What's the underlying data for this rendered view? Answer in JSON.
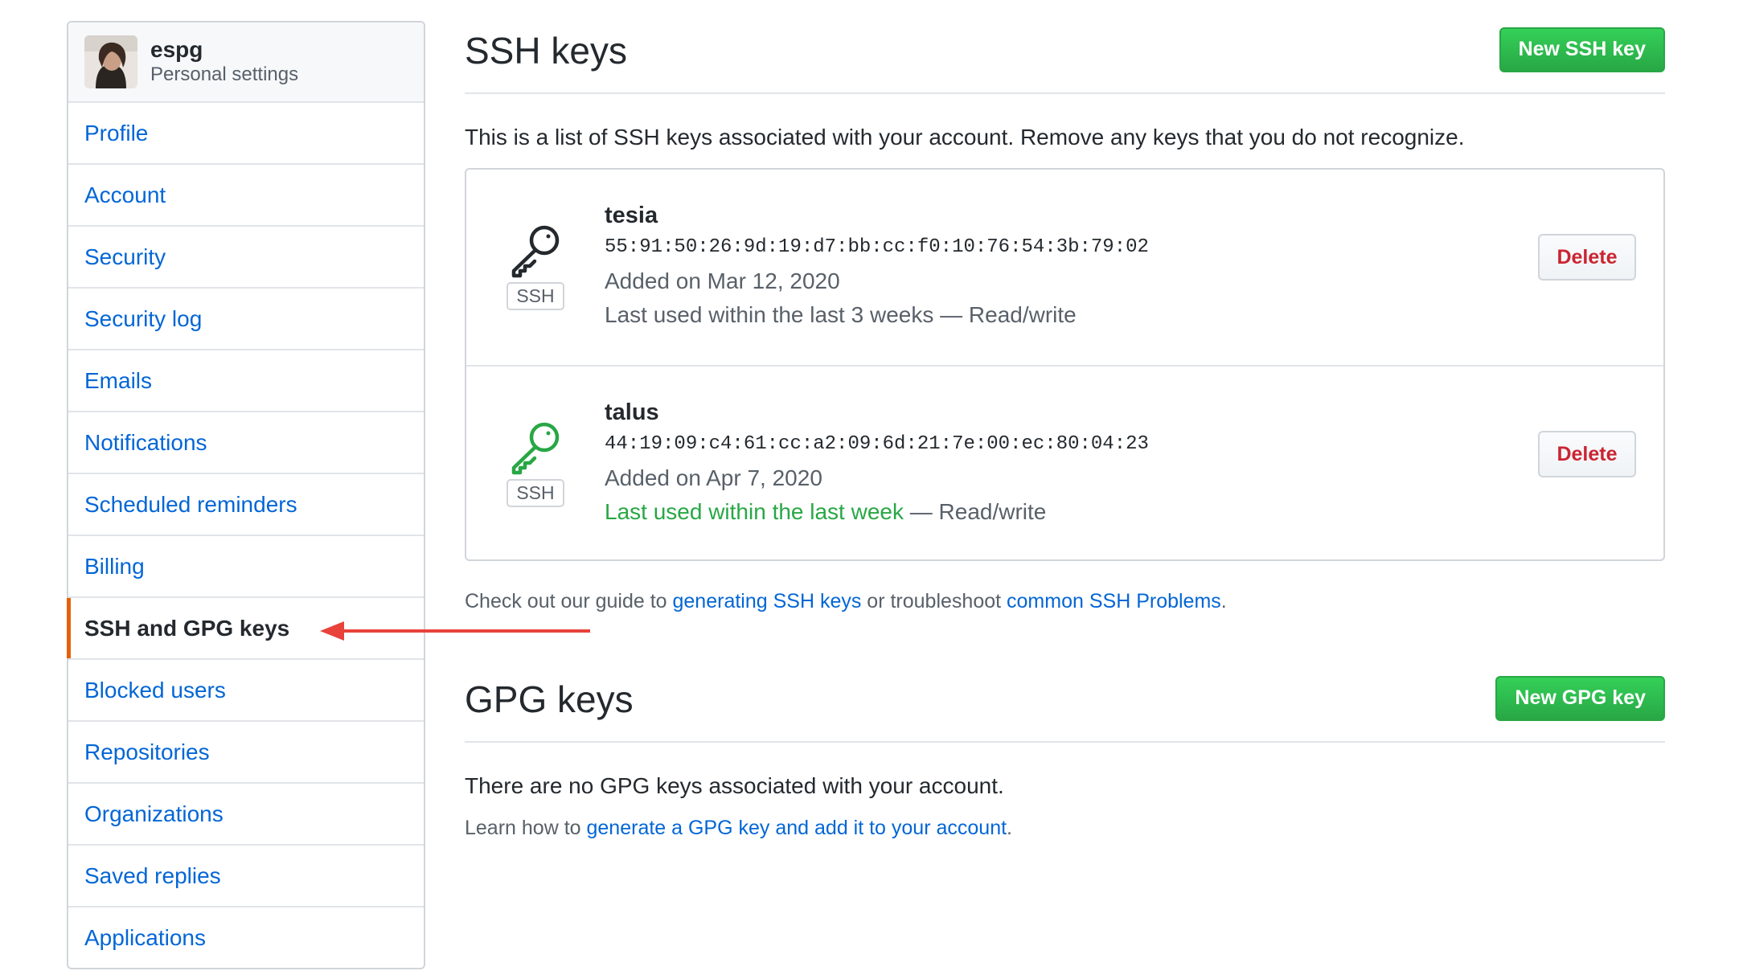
{
  "sidebar": {
    "username": "espg",
    "subtitle": "Personal settings",
    "items": [
      {
        "label": "Profile"
      },
      {
        "label": "Account"
      },
      {
        "label": "Security"
      },
      {
        "label": "Security log"
      },
      {
        "label": "Emails"
      },
      {
        "label": "Notifications"
      },
      {
        "label": "Scheduled reminders"
      },
      {
        "label": "Billing"
      },
      {
        "label": "SSH and GPG keys",
        "selected": true
      },
      {
        "label": "Blocked users"
      },
      {
        "label": "Repositories"
      },
      {
        "label": "Organizations"
      },
      {
        "label": "Saved replies"
      },
      {
        "label": "Applications"
      }
    ]
  },
  "ssh": {
    "title": "SSH keys",
    "new_button": "New SSH key",
    "intro": "This is a list of SSH keys associated with your account. Remove any keys that you do not recognize.",
    "keys": [
      {
        "name": "tesia",
        "type_label": "SSH",
        "fingerprint": "55:91:50:26:9d:19:d7:bb:cc:f0:10:76:54:3b:79:02",
        "added": "Added on Mar 12, 2020",
        "last_used": "Last used within the last 3 weeks",
        "access": " — Read/write",
        "icon_color": "#24292e",
        "delete_label": "Delete"
      },
      {
        "name": "talus",
        "type_label": "SSH",
        "fingerprint": "44:19:09:c4:61:cc:a2:09:6d:21:7e:00:ec:80:04:23",
        "added": "Added on Apr 7, 2020",
        "last_used": "Last used within the last week",
        "access": " — Read/write",
        "icon_color": "#28a745",
        "delete_label": "Delete"
      }
    ],
    "guide_prefix": "Check out our guide to ",
    "guide_link1": "generating SSH keys",
    "guide_middle": " or troubleshoot ",
    "guide_link2": "common SSH Problems",
    "guide_suffix": "."
  },
  "gpg": {
    "title": "GPG keys",
    "new_button": "New GPG key",
    "empty_text": "There are no GPG keys associated with your account.",
    "learn_prefix": "Learn how to ",
    "learn_link": "generate a GPG key and add it to your account",
    "learn_suffix": "."
  },
  "colors": {
    "link": "#0366d6",
    "accent_selected": "#e36209",
    "green": "#28a745",
    "danger": "#cb2431",
    "annotation_arrow": "#e8423a"
  }
}
